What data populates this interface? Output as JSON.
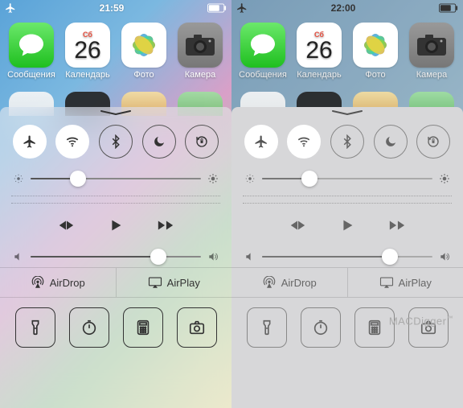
{
  "panels": [
    {
      "side": "left",
      "statusbar": {
        "time": "21:59"
      },
      "home_apps": {
        "messages_label": "Сообщения",
        "calendar_label": "Календарь",
        "calendar_day": "Сб",
        "calendar_date": "26",
        "photos_label": "Фото",
        "camera_label": "Камера"
      },
      "control_center": {
        "toggles": {
          "airplane": true,
          "wifi": true,
          "bluetooth": false,
          "dnd": false,
          "rotation_lock": false
        },
        "brightness_pct": 28,
        "volume_pct": 75,
        "airdrop_label": "AirDrop",
        "airplay_label": "AirPlay"
      }
    },
    {
      "side": "right",
      "statusbar": {
        "time": "22:00"
      },
      "home_apps": {
        "messages_label": "Сообщения",
        "calendar_label": "Календарь",
        "calendar_day": "Сб",
        "calendar_date": "26",
        "photos_label": "Фото",
        "camera_label": "Камера"
      },
      "control_center": {
        "toggles": {
          "airplane": true,
          "wifi": true,
          "bluetooth": false,
          "dnd": false,
          "rotation_lock": false
        },
        "brightness_pct": 28,
        "volume_pct": 75,
        "airdrop_label": "AirDrop",
        "airplay_label": "AirPlay"
      },
      "watermark": "MACDigger"
    }
  ],
  "icons": {
    "airplane": "airplane-icon",
    "wifi": "wifi-icon",
    "bluetooth": "bluetooth-icon",
    "dnd": "moon-icon",
    "rotation_lock": "rotation-lock-icon",
    "flashlight": "flashlight-icon",
    "timer": "timer-icon",
    "calculator": "calculator-icon",
    "camera": "camera-icon",
    "airdrop": "airdrop-icon",
    "airplay": "airplay-icon",
    "prev": "previous-track-icon",
    "play": "play-icon",
    "next": "next-track-icon",
    "brightness_low": "brightness-low-icon",
    "brightness_high": "brightness-high-icon",
    "volume_low": "volume-low-icon",
    "volume_high": "volume-high-icon",
    "grabber": "sheet-grabber-icon",
    "battery": "battery-icon"
  }
}
